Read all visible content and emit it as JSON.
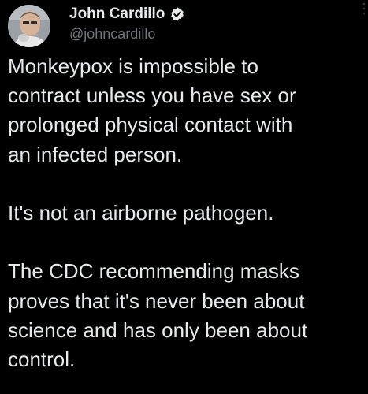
{
  "author": {
    "display_name": "John Cardillo",
    "handle": "@johncardillo",
    "verified": true
  },
  "avatar": {
    "icon": "user-avatar-photo"
  },
  "tweet": {
    "paragraphs": [
      {
        "lines": [
          "Monkeypox is impossible to",
          "contract unless you have sex or",
          "prolonged physical contact with",
          "an infected person."
        ]
      },
      {
        "lines": [
          "It's not an airborne pathogen."
        ]
      },
      {
        "lines": [
          "The CDC recommending masks",
          "proves that it's never been about",
          "science and has only been about",
          "control."
        ]
      }
    ]
  },
  "colors": {
    "background": "#000000",
    "text_primary": "#e7e9ea",
    "text_secondary": "#71767b",
    "verified_badge": "#e7e9ea"
  }
}
